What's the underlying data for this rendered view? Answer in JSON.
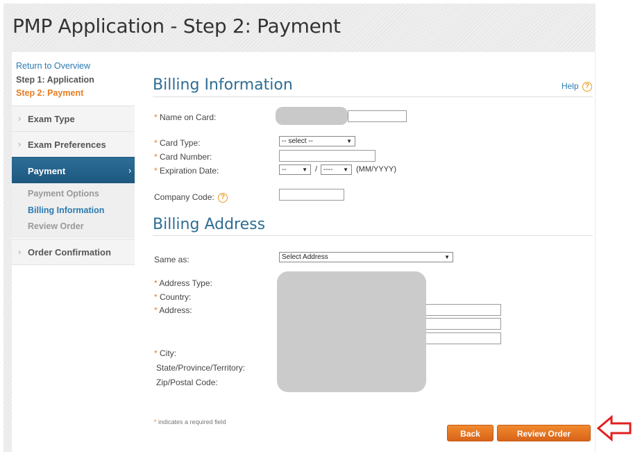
{
  "page": {
    "title": "PMP Application - Step 2: Payment"
  },
  "sidebar": {
    "return_link": "Return to Overview",
    "step1": "Step 1: Application",
    "step2": "Step 2: Payment",
    "items": [
      {
        "label": "Exam Type",
        "chevron": "›"
      },
      {
        "label": "Exam Preferences",
        "chevron": "›"
      },
      {
        "label": "Payment",
        "chevron": "›",
        "active": true
      },
      {
        "label": "Order Confirmation",
        "chevron": "›"
      }
    ],
    "subitems": [
      "Payment Options",
      "Billing Information",
      "Review Order"
    ],
    "active_subitem": "Billing Information"
  },
  "billing": {
    "title": "Billing Information",
    "help": "Help",
    "help_icon": "?",
    "required_mark": "*",
    "name_label": "Name on Card:",
    "card_type_label": "Card Type:",
    "card_type_value": "-- select --",
    "card_number_label": "Card Number:",
    "exp_label": "Expiration Date:",
    "exp_month": "--",
    "exp_sep": "/",
    "exp_year": "----",
    "exp_format": "(MM/YYYY)",
    "company_code_label": "Company Code:"
  },
  "address": {
    "title": "Billing Address",
    "same_as_label": "Same as:",
    "same_as_value": "Select Address",
    "address_type_label": "Address Type:",
    "country_label": "Country:",
    "address_label": "Address:",
    "city_label": "City:",
    "state_label": "State/Province/Territory:",
    "zip_label": "Zip/Postal Code:"
  },
  "footer": {
    "required_note": "indicates a required field",
    "back_button": "Back",
    "review_button": "Review Order"
  },
  "colors": {
    "accent_orange": "#e67d22",
    "link_blue": "#2a7ab0",
    "nav_active": "#1d587f",
    "annotation_red": "#e0201f"
  },
  "icons": {
    "select_arrow": "▼",
    "help": "question-circle-icon",
    "annotation": "red-arrow-icon"
  }
}
